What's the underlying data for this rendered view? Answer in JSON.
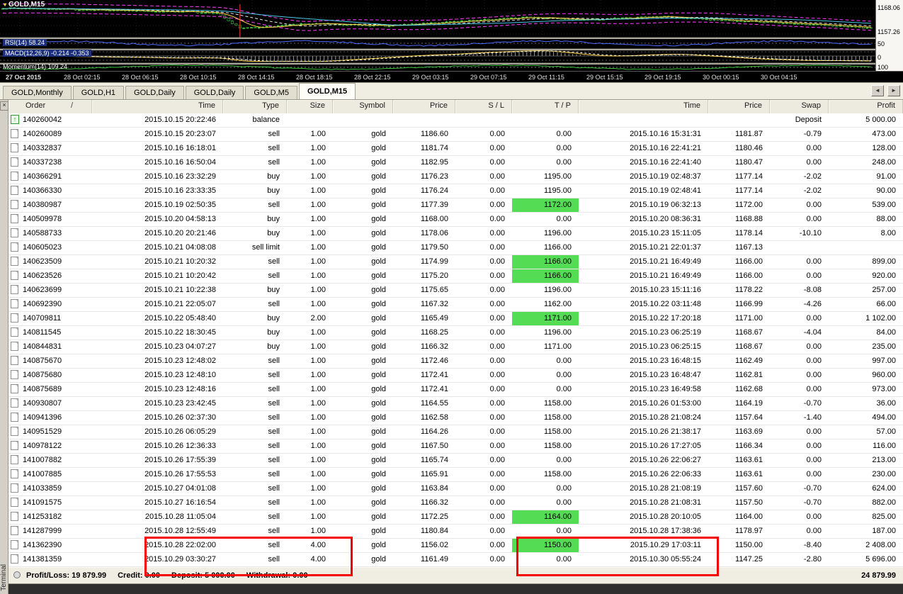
{
  "chart": {
    "symbol_label": "GOLD,M15",
    "rsi_label": "RSI(14) 58.24",
    "macd_label": "MACD(12,26,9) -0.214 -0.353",
    "momentum_label": "Momentum(14) 109.24",
    "scale_values": [
      "1168.06",
      "1157.26",
      "50",
      "0",
      "100"
    ],
    "time_axis": [
      "27 Oct 2015",
      "28 Oct 02:15",
      "28 Oct 06:15",
      "28 Oct 10:15",
      "28 Oct 14:15",
      "28 Oct 18:15",
      "28 Oct 22:15",
      "29 Oct 03:15",
      "29 Oct 07:15",
      "29 Oct 11:15",
      "29 Oct 15:15",
      "29 Oct 19:15",
      "30 Oct 00:15",
      "30 Oct 04:15"
    ],
    "colors": {
      "candle": "#3cc43c",
      "band": "#ff3cff",
      "fast_ma": "#ffd24a",
      "slow_ma": "#49c8e8",
      "rsi": "#4f6bff",
      "background": "#000000"
    }
  },
  "icons": {
    "symbol_dropdown": "▾",
    "close": "×",
    "scroll_left": "◄",
    "scroll_right": "►",
    "balance_arrow": "↑",
    "sort": "/"
  },
  "tabs": {
    "items": [
      "GOLD,Monthly",
      "GOLD,H1",
      "GOLD,Daily",
      "GOLD,Daily",
      "GOLD,M5",
      "GOLD,M15"
    ],
    "active_index": 5
  },
  "terminal": {
    "side_label": "Terminal"
  },
  "history": {
    "columns": [
      {
        "key": "order",
        "label": "Order",
        "sort": "/"
      },
      {
        "key": "time",
        "label": "Time"
      },
      {
        "key": "type",
        "label": "Type"
      },
      {
        "key": "size",
        "label": "Size"
      },
      {
        "key": "symbol",
        "label": "Symbol"
      },
      {
        "key": "price",
        "label": "Price"
      },
      {
        "key": "sl",
        "label": "S / L"
      },
      {
        "key": "tp",
        "label": "T / P"
      },
      {
        "key": "close_time",
        "label": "Time"
      },
      {
        "key": "close_price",
        "label": "Price"
      },
      {
        "key": "swap",
        "label": "Swap"
      },
      {
        "key": "profit",
        "label": "Profit"
      }
    ],
    "highlight_color": "#54dc54",
    "rows": [
      {
        "order": "140260042",
        "time": "2015.10.15 20:22:46",
        "type": "balance",
        "size": "",
        "symbol": "",
        "price": "",
        "sl": "",
        "tp": "",
        "ctime": "",
        "cprice": "",
        "swap": "Deposit",
        "profit": "5 000.00"
      },
      {
        "order": "140260089",
        "time": "2015.10.15 20:23:07",
        "type": "sell",
        "size": "1.00",
        "symbol": "gold",
        "price": "1186.60",
        "sl": "0.00",
        "tp": "0.00",
        "ctime": "2015.10.16 15:31:31",
        "cprice": "1181.87",
        "swap": "-0.79",
        "profit": "473.00"
      },
      {
        "order": "140332837",
        "time": "2015.10.16 16:18:01",
        "type": "sell",
        "size": "1.00",
        "symbol": "gold",
        "price": "1181.74",
        "sl": "0.00",
        "tp": "0.00",
        "ctime": "2015.10.16 22:41:21",
        "cprice": "1180.46",
        "swap": "0.00",
        "profit": "128.00"
      },
      {
        "order": "140337238",
        "time": "2015.10.16 16:50:04",
        "type": "sell",
        "size": "1.00",
        "symbol": "gold",
        "price": "1182.95",
        "sl": "0.00",
        "tp": "0.00",
        "ctime": "2015.10.16 22:41:40",
        "cprice": "1180.47",
        "swap": "0.00",
        "profit": "248.00"
      },
      {
        "order": "140366291",
        "time": "2015.10.16 23:32:29",
        "type": "buy",
        "size": "1.00",
        "symbol": "gold",
        "price": "1176.23",
        "sl": "0.00",
        "tp": "1195.00",
        "ctime": "2015.10.19 02:48:37",
        "cprice": "1177.14",
        "swap": "-2.02",
        "profit": "91.00"
      },
      {
        "order": "140366330",
        "time": "2015.10.16 23:33:35",
        "type": "buy",
        "size": "1.00",
        "symbol": "gold",
        "price": "1176.24",
        "sl": "0.00",
        "tp": "1195.00",
        "ctime": "2015.10.19 02:48:41",
        "cprice": "1177.14",
        "swap": "-2.02",
        "profit": "90.00"
      },
      {
        "order": "140380987",
        "time": "2015.10.19 02:50:35",
        "type": "sell",
        "size": "1.00",
        "symbol": "gold",
        "price": "1177.39",
        "sl": "0.00",
        "tp": "1172.00",
        "tp_hl": true,
        "ctime": "2015.10.19 06:32:13",
        "cprice": "1172.00",
        "swap": "0.00",
        "profit": "539.00"
      },
      {
        "order": "140509978",
        "time": "2015.10.20 04:58:13",
        "type": "buy",
        "size": "1.00",
        "symbol": "gold",
        "price": "1168.00",
        "sl": "0.00",
        "tp": "0.00",
        "ctime": "2015.10.20 08:36:31",
        "cprice": "1168.88",
        "swap": "0.00",
        "profit": "88.00"
      },
      {
        "order": "140588733",
        "time": "2015.10.20 20:21:46",
        "type": "buy",
        "size": "1.00",
        "symbol": "gold",
        "price": "1178.06",
        "sl": "0.00",
        "tp": "1196.00",
        "ctime": "2015.10.23 15:11:05",
        "cprice": "1178.14",
        "swap": "-10.10",
        "profit": "8.00"
      },
      {
        "order": "140605023",
        "time": "2015.10.21 04:08:08",
        "type": "sell limit",
        "size": "1.00",
        "symbol": "gold",
        "price": "1179.50",
        "sl": "0.00",
        "tp": "1166.00",
        "ctime": "2015.10.21 22:01:37",
        "cprice": "1167.13",
        "swap": "",
        "profit": ""
      },
      {
        "order": "140623509",
        "time": "2015.10.21 10:20:32",
        "type": "sell",
        "size": "1.00",
        "symbol": "gold",
        "price": "1174.99",
        "sl": "0.00",
        "tp": "1166.00",
        "tp_hl": true,
        "ctime": "2015.10.21 16:49:49",
        "cprice": "1166.00",
        "swap": "0.00",
        "profit": "899.00"
      },
      {
        "order": "140623526",
        "time": "2015.10.21 10:20:42",
        "type": "sell",
        "size": "1.00",
        "symbol": "gold",
        "price": "1175.20",
        "sl": "0.00",
        "tp": "1166.00",
        "tp_hl": true,
        "ctime": "2015.10.21 16:49:49",
        "cprice": "1166.00",
        "swap": "0.00",
        "profit": "920.00"
      },
      {
        "order": "140623699",
        "time": "2015.10.21 10:22:38",
        "type": "buy",
        "size": "1.00",
        "symbol": "gold",
        "price": "1175.65",
        "sl": "0.00",
        "tp": "1196.00",
        "ctime": "2015.10.23 15:11:16",
        "cprice": "1178.22",
        "swap": "-8.08",
        "profit": "257.00"
      },
      {
        "order": "140692390",
        "time": "2015.10.21 22:05:07",
        "type": "sell",
        "size": "1.00",
        "symbol": "gold",
        "price": "1167.32",
        "sl": "0.00",
        "tp": "1162.00",
        "ctime": "2015.10.22 03:11:48",
        "cprice": "1166.99",
        "swap": "-4.26",
        "profit": "66.00"
      },
      {
        "order": "140709811",
        "time": "2015.10.22 05:48:40",
        "type": "buy",
        "size": "2.00",
        "symbol": "gold",
        "price": "1165.49",
        "sl": "0.00",
        "tp": "1171.00",
        "tp_hl": true,
        "ctime": "2015.10.22 17:20:18",
        "cprice": "1171.00",
        "swap": "0.00",
        "profit": "1 102.00"
      },
      {
        "order": "140811545",
        "time": "2015.10.22 18:30:45",
        "type": "buy",
        "size": "1.00",
        "symbol": "gold",
        "price": "1168.25",
        "sl": "0.00",
        "tp": "1196.00",
        "ctime": "2015.10.23 06:25:19",
        "cprice": "1168.67",
        "swap": "-4.04",
        "profit": "84.00"
      },
      {
        "order": "140844831",
        "time": "2015.10.23 04:07:27",
        "type": "buy",
        "size": "1.00",
        "symbol": "gold",
        "price": "1166.32",
        "sl": "0.00",
        "tp": "1171.00",
        "ctime": "2015.10.23 06:25:15",
        "cprice": "1168.67",
        "swap": "0.00",
        "profit": "235.00"
      },
      {
        "order": "140875670",
        "time": "2015.10.23 12:48:02",
        "type": "sell",
        "size": "1.00",
        "symbol": "gold",
        "price": "1172.46",
        "sl": "0.00",
        "tp": "0.00",
        "ctime": "2015.10.23 16:48:15",
        "cprice": "1162.49",
        "swap": "0.00",
        "profit": "997.00"
      },
      {
        "order": "140875680",
        "time": "2015.10.23 12:48:10",
        "type": "sell",
        "size": "1.00",
        "symbol": "gold",
        "price": "1172.41",
        "sl": "0.00",
        "tp": "0.00",
        "ctime": "2015.10.23 16:48:47",
        "cprice": "1162.81",
        "swap": "0.00",
        "profit": "960.00"
      },
      {
        "order": "140875689",
        "time": "2015.10.23 12:48:16",
        "type": "sell",
        "size": "1.00",
        "symbol": "gold",
        "price": "1172.41",
        "sl": "0.00",
        "tp": "0.00",
        "ctime": "2015.10.23 16:49:58",
        "cprice": "1162.68",
        "swap": "0.00",
        "profit": "973.00"
      },
      {
        "order": "140930807",
        "time": "2015.10.23 23:42:45",
        "type": "sell",
        "size": "1.00",
        "symbol": "gold",
        "price": "1164.55",
        "sl": "0.00",
        "tp": "1158.00",
        "ctime": "2015.10.26 01:53:00",
        "cprice": "1164.19",
        "swap": "-0.70",
        "profit": "36.00"
      },
      {
        "order": "140941396",
        "time": "2015.10.26 02:37:30",
        "type": "sell",
        "size": "1.00",
        "symbol": "gold",
        "price": "1162.58",
        "sl": "0.00",
        "tp": "1158.00",
        "ctime": "2015.10.28 21:08:24",
        "cprice": "1157.64",
        "swap": "-1.40",
        "profit": "494.00"
      },
      {
        "order": "140951529",
        "time": "2015.10.26 06:05:29",
        "type": "sell",
        "size": "1.00",
        "symbol": "gold",
        "price": "1164.26",
        "sl": "0.00",
        "tp": "1158.00",
        "ctime": "2015.10.26 21:38:17",
        "cprice": "1163.69",
        "swap": "0.00",
        "profit": "57.00"
      },
      {
        "order": "140978122",
        "time": "2015.10.26 12:36:33",
        "type": "sell",
        "size": "1.00",
        "symbol": "gold",
        "price": "1167.50",
        "sl": "0.00",
        "tp": "1158.00",
        "ctime": "2015.10.26 17:27:05",
        "cprice": "1166.34",
        "swap": "0.00",
        "profit": "116.00"
      },
      {
        "order": "141007882",
        "time": "2015.10.26 17:55:39",
        "type": "sell",
        "size": "1.00",
        "symbol": "gold",
        "price": "1165.74",
        "sl": "0.00",
        "tp": "0.00",
        "ctime": "2015.10.26 22:06:27",
        "cprice": "1163.61",
        "swap": "0.00",
        "profit": "213.00"
      },
      {
        "order": "141007885",
        "time": "2015.10.26 17:55:53",
        "type": "sell",
        "size": "1.00",
        "symbol": "gold",
        "price": "1165.91",
        "sl": "0.00",
        "tp": "1158.00",
        "ctime": "2015.10.26 22:06:33",
        "cprice": "1163.61",
        "swap": "0.00",
        "profit": "230.00"
      },
      {
        "order": "141033859",
        "time": "2015.10.27 04:01:08",
        "type": "sell",
        "size": "1.00",
        "symbol": "gold",
        "price": "1163.84",
        "sl": "0.00",
        "tp": "0.00",
        "ctime": "2015.10.28 21:08:19",
        "cprice": "1157.60",
        "swap": "-0.70",
        "profit": "624.00"
      },
      {
        "order": "141091575",
        "time": "2015.10.27 16:16:54",
        "type": "sell",
        "size": "1.00",
        "symbol": "gold",
        "price": "1166.32",
        "sl": "0.00",
        "tp": "0.00",
        "ctime": "2015.10.28 21:08:31",
        "cprice": "1157.50",
        "swap": "-0.70",
        "profit": "882.00"
      },
      {
        "order": "141253182",
        "time": "2015.10.28 11:05:04",
        "type": "sell",
        "size": "1.00",
        "symbol": "gold",
        "price": "1172.25",
        "sl": "0.00",
        "tp": "1164.00",
        "tp_hl": true,
        "ctime": "2015.10.28 20:10:05",
        "cprice": "1164.00",
        "swap": "0.00",
        "profit": "825.00"
      },
      {
        "order": "141287999",
        "time": "2015.10.28 12:55:49",
        "type": "sell",
        "size": "1.00",
        "symbol": "gold",
        "price": "1180.84",
        "sl": "0.00",
        "tp": "0.00",
        "ctime": "2015.10.28 17:38:36",
        "cprice": "1178.97",
        "swap": "0.00",
        "profit": "187.00"
      },
      {
        "order": "141362390",
        "time": "2015.10.28 22:02:00",
        "type": "sell",
        "size": "4.00",
        "symbol": "gold",
        "price": "1156.02",
        "sl": "0.00",
        "tp": "1150.00",
        "tp_hl": true,
        "ctime": "2015.10.29 17:03:11",
        "cprice": "1150.00",
        "swap": "-8.40",
        "profit": "2 408.00"
      },
      {
        "order": "141381359",
        "time": "2015.10.29 03:30:27",
        "type": "sell",
        "size": "4.00",
        "symbol": "gold",
        "price": "1161.49",
        "sl": "0.00",
        "tp": "0.00",
        "ctime": "2015.10.30 05:55:24",
        "cprice": "1147.25",
        "swap": "-2.80",
        "profit": "5 696.00"
      }
    ]
  },
  "annotations": {
    "color": "#f40000"
  },
  "status": {
    "items": [
      "Profit/Loss: 19 879.99",
      "Credit: 0.00",
      "Deposit: 5 000.00",
      "Withdrawal: 0.00"
    ],
    "total": "24 879.99"
  }
}
